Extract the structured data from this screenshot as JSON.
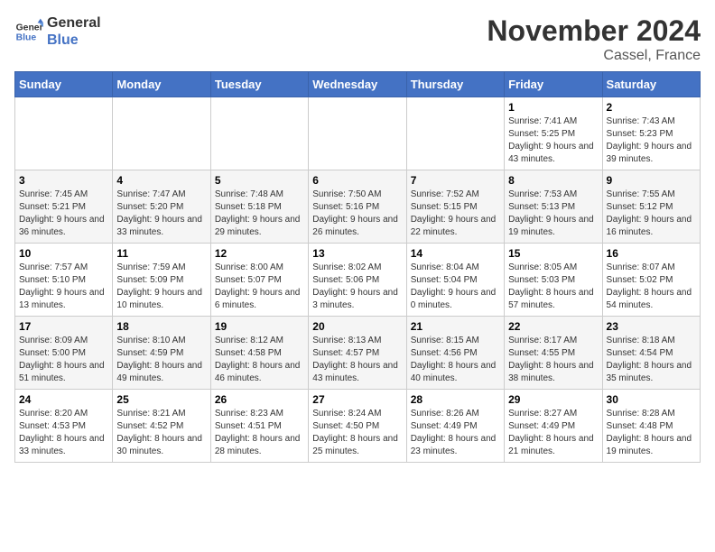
{
  "logo": {
    "line1": "General",
    "line2": "Blue"
  },
  "title": "November 2024",
  "location": "Cassel, France",
  "days_header": [
    "Sunday",
    "Monday",
    "Tuesday",
    "Wednesday",
    "Thursday",
    "Friday",
    "Saturday"
  ],
  "weeks": [
    [
      {
        "day": "",
        "info": ""
      },
      {
        "day": "",
        "info": ""
      },
      {
        "day": "",
        "info": ""
      },
      {
        "day": "",
        "info": ""
      },
      {
        "day": "",
        "info": ""
      },
      {
        "day": "1",
        "info": "Sunrise: 7:41 AM\nSunset: 5:25 PM\nDaylight: 9 hours and 43 minutes."
      },
      {
        "day": "2",
        "info": "Sunrise: 7:43 AM\nSunset: 5:23 PM\nDaylight: 9 hours and 39 minutes."
      }
    ],
    [
      {
        "day": "3",
        "info": "Sunrise: 7:45 AM\nSunset: 5:21 PM\nDaylight: 9 hours and 36 minutes."
      },
      {
        "day": "4",
        "info": "Sunrise: 7:47 AM\nSunset: 5:20 PM\nDaylight: 9 hours and 33 minutes."
      },
      {
        "day": "5",
        "info": "Sunrise: 7:48 AM\nSunset: 5:18 PM\nDaylight: 9 hours and 29 minutes."
      },
      {
        "day": "6",
        "info": "Sunrise: 7:50 AM\nSunset: 5:16 PM\nDaylight: 9 hours and 26 minutes."
      },
      {
        "day": "7",
        "info": "Sunrise: 7:52 AM\nSunset: 5:15 PM\nDaylight: 9 hours and 22 minutes."
      },
      {
        "day": "8",
        "info": "Sunrise: 7:53 AM\nSunset: 5:13 PM\nDaylight: 9 hours and 19 minutes."
      },
      {
        "day": "9",
        "info": "Sunrise: 7:55 AM\nSunset: 5:12 PM\nDaylight: 9 hours and 16 minutes."
      }
    ],
    [
      {
        "day": "10",
        "info": "Sunrise: 7:57 AM\nSunset: 5:10 PM\nDaylight: 9 hours and 13 minutes."
      },
      {
        "day": "11",
        "info": "Sunrise: 7:59 AM\nSunset: 5:09 PM\nDaylight: 9 hours and 10 minutes."
      },
      {
        "day": "12",
        "info": "Sunrise: 8:00 AM\nSunset: 5:07 PM\nDaylight: 9 hours and 6 minutes."
      },
      {
        "day": "13",
        "info": "Sunrise: 8:02 AM\nSunset: 5:06 PM\nDaylight: 9 hours and 3 minutes."
      },
      {
        "day": "14",
        "info": "Sunrise: 8:04 AM\nSunset: 5:04 PM\nDaylight: 9 hours and 0 minutes."
      },
      {
        "day": "15",
        "info": "Sunrise: 8:05 AM\nSunset: 5:03 PM\nDaylight: 8 hours and 57 minutes."
      },
      {
        "day": "16",
        "info": "Sunrise: 8:07 AM\nSunset: 5:02 PM\nDaylight: 8 hours and 54 minutes."
      }
    ],
    [
      {
        "day": "17",
        "info": "Sunrise: 8:09 AM\nSunset: 5:00 PM\nDaylight: 8 hours and 51 minutes."
      },
      {
        "day": "18",
        "info": "Sunrise: 8:10 AM\nSunset: 4:59 PM\nDaylight: 8 hours and 49 minutes."
      },
      {
        "day": "19",
        "info": "Sunrise: 8:12 AM\nSunset: 4:58 PM\nDaylight: 8 hours and 46 minutes."
      },
      {
        "day": "20",
        "info": "Sunrise: 8:13 AM\nSunset: 4:57 PM\nDaylight: 8 hours and 43 minutes."
      },
      {
        "day": "21",
        "info": "Sunrise: 8:15 AM\nSunset: 4:56 PM\nDaylight: 8 hours and 40 minutes."
      },
      {
        "day": "22",
        "info": "Sunrise: 8:17 AM\nSunset: 4:55 PM\nDaylight: 8 hours and 38 minutes."
      },
      {
        "day": "23",
        "info": "Sunrise: 8:18 AM\nSunset: 4:54 PM\nDaylight: 8 hours and 35 minutes."
      }
    ],
    [
      {
        "day": "24",
        "info": "Sunrise: 8:20 AM\nSunset: 4:53 PM\nDaylight: 8 hours and 33 minutes."
      },
      {
        "day": "25",
        "info": "Sunrise: 8:21 AM\nSunset: 4:52 PM\nDaylight: 8 hours and 30 minutes."
      },
      {
        "day": "26",
        "info": "Sunrise: 8:23 AM\nSunset: 4:51 PM\nDaylight: 8 hours and 28 minutes."
      },
      {
        "day": "27",
        "info": "Sunrise: 8:24 AM\nSunset: 4:50 PM\nDaylight: 8 hours and 25 minutes."
      },
      {
        "day": "28",
        "info": "Sunrise: 8:26 AM\nSunset: 4:49 PM\nDaylight: 8 hours and 23 minutes."
      },
      {
        "day": "29",
        "info": "Sunrise: 8:27 AM\nSunset: 4:49 PM\nDaylight: 8 hours and 21 minutes."
      },
      {
        "day": "30",
        "info": "Sunrise: 8:28 AM\nSunset: 4:48 PM\nDaylight: 8 hours and 19 minutes."
      }
    ]
  ]
}
